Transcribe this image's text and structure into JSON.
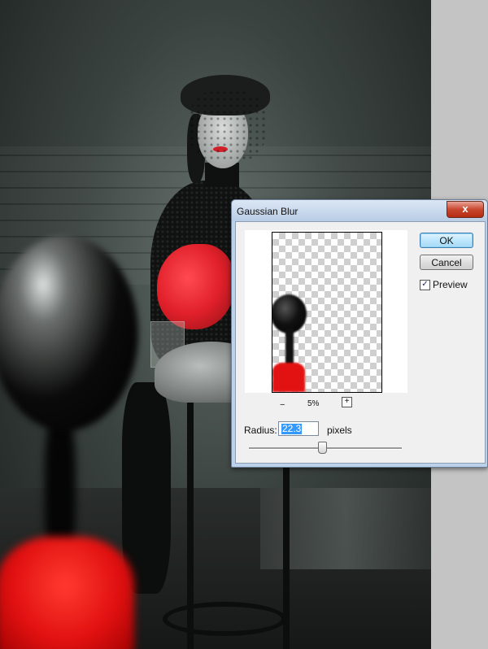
{
  "dialog": {
    "title": "Gaussian Blur",
    "close_glyph": "x",
    "ok_label": "OK",
    "cancel_label": "Cancel",
    "preview_label": "Preview",
    "preview_checked": true,
    "check_glyph": "✓",
    "zoom_out_glyph": "−",
    "zoom_level": "5%",
    "zoom_in_glyph": "+",
    "radius_label": "Radius:",
    "radius_value": "22.3",
    "radius_unit": "pixels",
    "slider_fraction": 0.48
  },
  "colors": {
    "accent_red": "#e31212",
    "dialog_frame": "#bcd1ea",
    "close_button": "#c8472f",
    "ok_button": "#bde6fd",
    "selection": "#3399ff"
  }
}
